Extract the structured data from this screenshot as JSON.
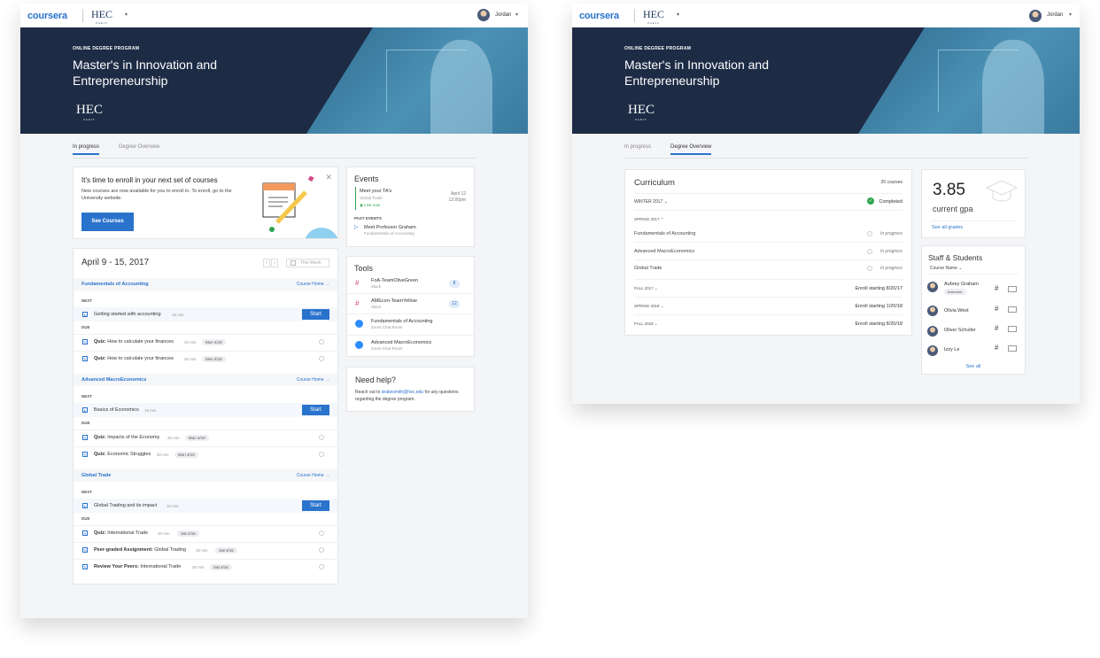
{
  "brand": {
    "logo": "coursera",
    "partner": "HEC",
    "partner_sub": "PARIS",
    "user": "Jordan"
  },
  "hero": {
    "eyebrow": "ONLINE DEGREE PROGRAM",
    "title": "Master's in Innovation and Entrepreneurship",
    "logo": "HEC",
    "logo_sub": "PARIS"
  },
  "tabs": {
    "in_progress": "In progress",
    "degree_overview": "Degree Overview"
  },
  "enroll": {
    "title": "It's time to enroll in your next set of courses",
    "body": "New courses are now available for you to enroll in. To enroll, go to the University website.",
    "button": "See Courses"
  },
  "events": {
    "title": "Events",
    "current": {
      "title": "Meet your TA's",
      "course": "Global Trade",
      "status": "Live now",
      "date": "April 12",
      "time": "12:00pm"
    },
    "past_label": "PAST EVENTS",
    "past": {
      "title": "Meet Professor Graham",
      "course": "Fundamentals of Accounting"
    }
  },
  "tools": {
    "title": "Tools",
    "items": [
      {
        "name": "FoA-TeamOliveGreen",
        "sub": "Slack",
        "badge": "8"
      },
      {
        "name": "AMEcon-TeamYellow",
        "sub": "Slack",
        "badge": "12"
      },
      {
        "name": "Fundamentals of Accounting",
        "sub": "Zoom Chat Room"
      },
      {
        "name": "Advanced MacroEconomics",
        "sub": "Zoom Chat Room"
      }
    ]
  },
  "help": {
    "title": "Need help?",
    "pre": "Reach out to ",
    "email": "drakesmith@hec.edu",
    "post": " for any questions regarding the degree program."
  },
  "week": {
    "title": "April 9 - 15, 2017",
    "this_week": "This Week"
  },
  "labels": {
    "next": "NEXT",
    "due": "DUE",
    "start": "Start",
    "course_home": "Course Home →"
  },
  "courses": [
    {
      "name": "Fundamentals of Accounting",
      "next": {
        "title": "Getting started with accounting",
        "dur": "15 min"
      },
      "due": [
        {
          "kind": "Quiz:",
          "title": "How to calculate your finances",
          "dur": "30 min",
          "date": "Mon 4/10"
        },
        {
          "kind": "Quiz:",
          "title": "How to calculate your finances",
          "dur": "30 min",
          "date": "Mon 4/10"
        }
      ]
    },
    {
      "name": "Advanced MacroEconomics",
      "next": {
        "title": "Basics of Economics",
        "dur": "15 min"
      },
      "due": [
        {
          "kind": "Quiz:",
          "title": "Impacts of the Economy",
          "dur": "30 min",
          "date": "Mon 4/10"
        },
        {
          "kind": "Quiz:",
          "title": "Economic Struggles",
          "dur": "30 min",
          "date": "Mon 4/10"
        }
      ]
    },
    {
      "name": "Global Trade",
      "next": {
        "title": "Global Trading and its impact",
        "dur": "15 min"
      },
      "due": [
        {
          "kind": "Quiz:",
          "title": "International Trade",
          "dur": "30 min",
          "date": "Sat 4/16"
        },
        {
          "kind": "Peer-graded Assignment:",
          "title": "Global Trading",
          "dur": "30 min",
          "date": "Sat 4/16"
        },
        {
          "kind": "Review Your Peers:",
          "title": "International Trade",
          "dur": "30 min",
          "date": "Sat 4/16"
        }
      ]
    }
  ],
  "curriculum": {
    "title": "Curriculum",
    "count": "20 courses",
    "winter": {
      "term": "WINTER 2017",
      "status": "Completed"
    },
    "spring": {
      "term": "SPRING 2017",
      "courses": [
        {
          "name": "Fundamentals of Accounting",
          "status": "In progress"
        },
        {
          "name": "Advanced MacroEconomics",
          "status": "In progress"
        },
        {
          "name": "Global Trade",
          "status": "In progress"
        }
      ]
    },
    "future": [
      {
        "term": "FALL 2017",
        "status": "Enroll starting 8/20/17"
      },
      {
        "term": "SPRING 2018",
        "status": "Enroll starting 1/20/18"
      },
      {
        "term": "FALL 2018",
        "status": "Enroll starting 8/20/18"
      }
    ]
  },
  "gpa": {
    "value": "3.85",
    "label": "current gpa",
    "link": "See all grades"
  },
  "staff": {
    "title": "Staff & Students",
    "sort": "Course Name",
    "people": [
      {
        "name": "Aubrey Graham",
        "role": "Instructor"
      },
      {
        "name": "Olivia West"
      },
      {
        "name": "Oliver Schuller"
      },
      {
        "name": "Izzy Le"
      }
    ],
    "see_all": "See all"
  },
  "colors": {
    "accent": "#2a73cc",
    "hero": "#1d2b45",
    "success": "#2ea44f"
  }
}
